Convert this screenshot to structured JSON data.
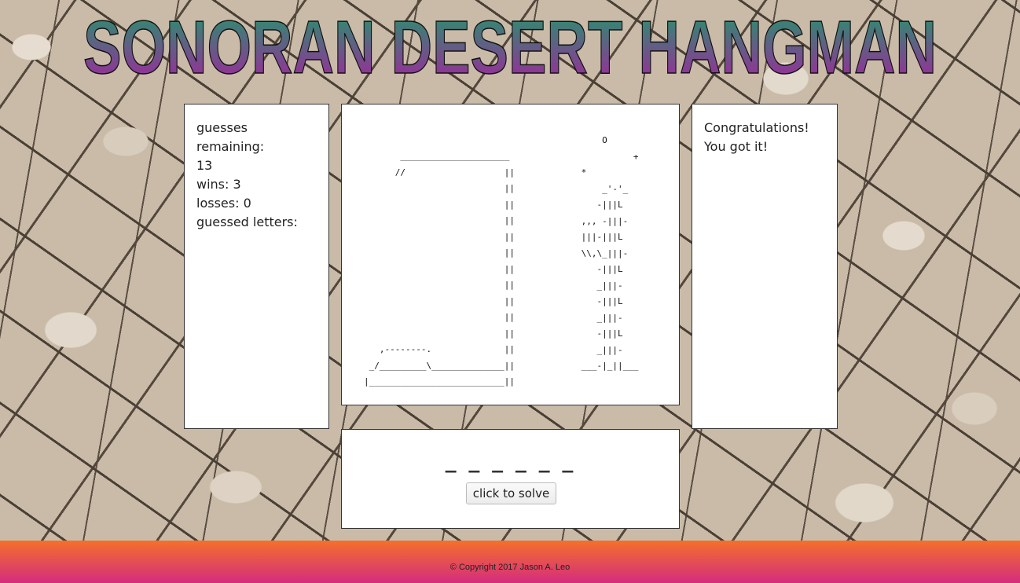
{
  "header": {
    "title": "SONORAN DESERT HANGMAN",
    "gradient_top": "#1f9a6a",
    "gradient_bottom": "#a81fa0"
  },
  "stats": {
    "guesses_label": "guesses remaining:",
    "guesses_value": "13",
    "wins": "wins: 3",
    "losses": "losses: 0",
    "guessed_label": "guessed letters:"
  },
  "art": {
    "gallows": "       _____________________\n      //                   ||\n                           ||\n                           ||\n                           ||\n                           ||\n                           ||\n                           ||\n                           ||\n                           ||\n                           ||\n                           ||\n   ,--------.              ||\n _/_________\\______________||\n|__________________________||",
    "cactus": "     O\n           +\n *\n     _'-'_\n    -|||L\n ,,, -|||-\n |||-|||L\n \\\\,\\_|||-\n    -|||L\n    _|||-\n    -|||L\n    _|||-\n    -|||L\n    _|||-\n ___-|_||___"
  },
  "message": {
    "line1": "Congratulations!",
    "line2": "You got it!"
  },
  "word": {
    "display": "_ _ _ _ _ _",
    "solve_label": "click to solve"
  },
  "footer": {
    "copyright": "© Copyright 2017 Jason A. Leo"
  }
}
